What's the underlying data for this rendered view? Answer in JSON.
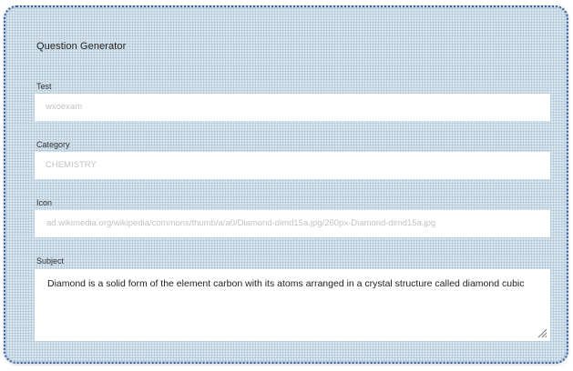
{
  "form": {
    "title": "Question Generator",
    "fields": {
      "test": {
        "label": "Test",
        "value": "wxoexam"
      },
      "category": {
        "label": "Category",
        "value": "CHEMISTRY"
      },
      "icon": {
        "label": "Icon",
        "value": "ad.wikimedia.org/wikipedia/commons/thumb/a/a0/Diamond-dimd15a.jpg/260px-Diamond-dimd15a.jpg"
      },
      "subject": {
        "label": "Subject",
        "value": "Diamond is a solid form of the element carbon with its atoms arranged in a crystal structure called diamond cubic"
      }
    }
  },
  "colors": {
    "frame_border": "#3d5f99",
    "frame_fill": "#dde8ef",
    "input_background": "#ffffff",
    "input_text_muted": "#c2c2c2",
    "textarea_text": "#1e1e1e"
  },
  "icons": {
    "resize_handle": "resize-grip-icon"
  }
}
